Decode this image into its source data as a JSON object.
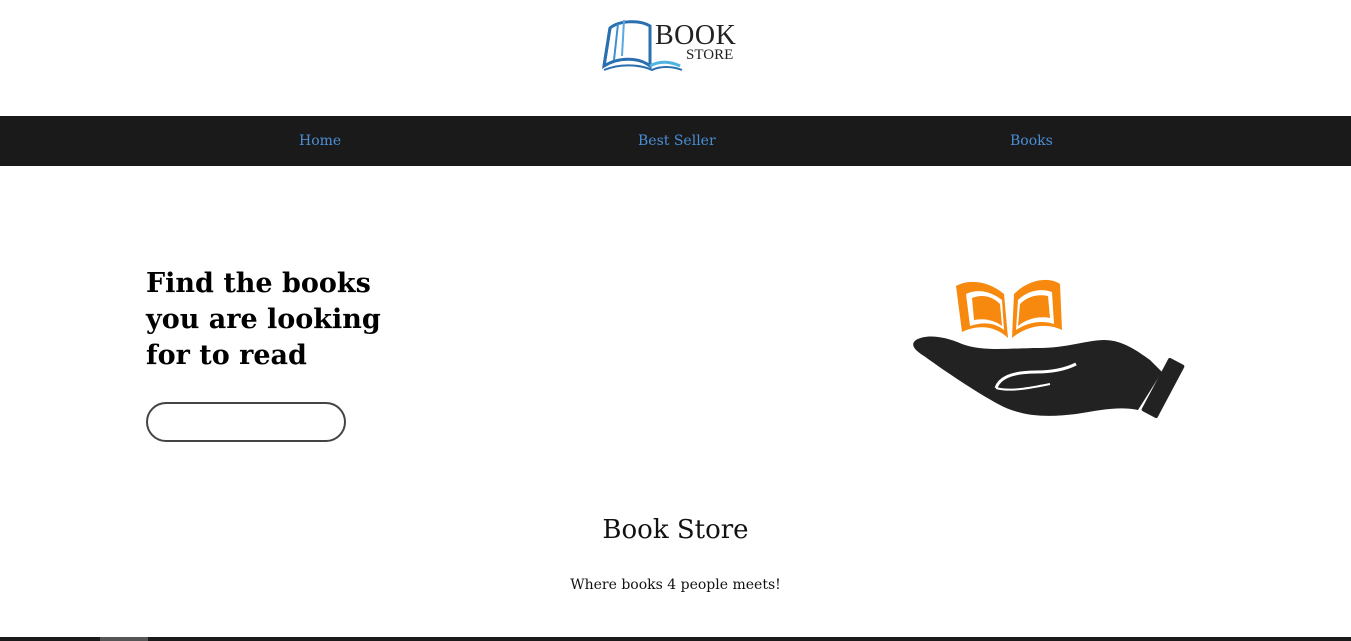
{
  "header": {
    "logo_word": "BOOK",
    "logo_sub": "STORE",
    "logo_icon": "open-book-icon"
  },
  "nav": {
    "items": [
      {
        "label": "Home"
      },
      {
        "label": "Best Seller"
      },
      {
        "label": "Books"
      }
    ],
    "link_color": "#4a8fd6",
    "background": "#1a1a1a"
  },
  "hero": {
    "title": "Find the books you are looking for to read",
    "button_label": "",
    "illustration": "hand-holding-book-icon",
    "book_color": "#f7890f",
    "hand_color": "#222222"
  },
  "footer": {
    "title": "Book Store",
    "tagline": "Where books 4 people meets!"
  }
}
